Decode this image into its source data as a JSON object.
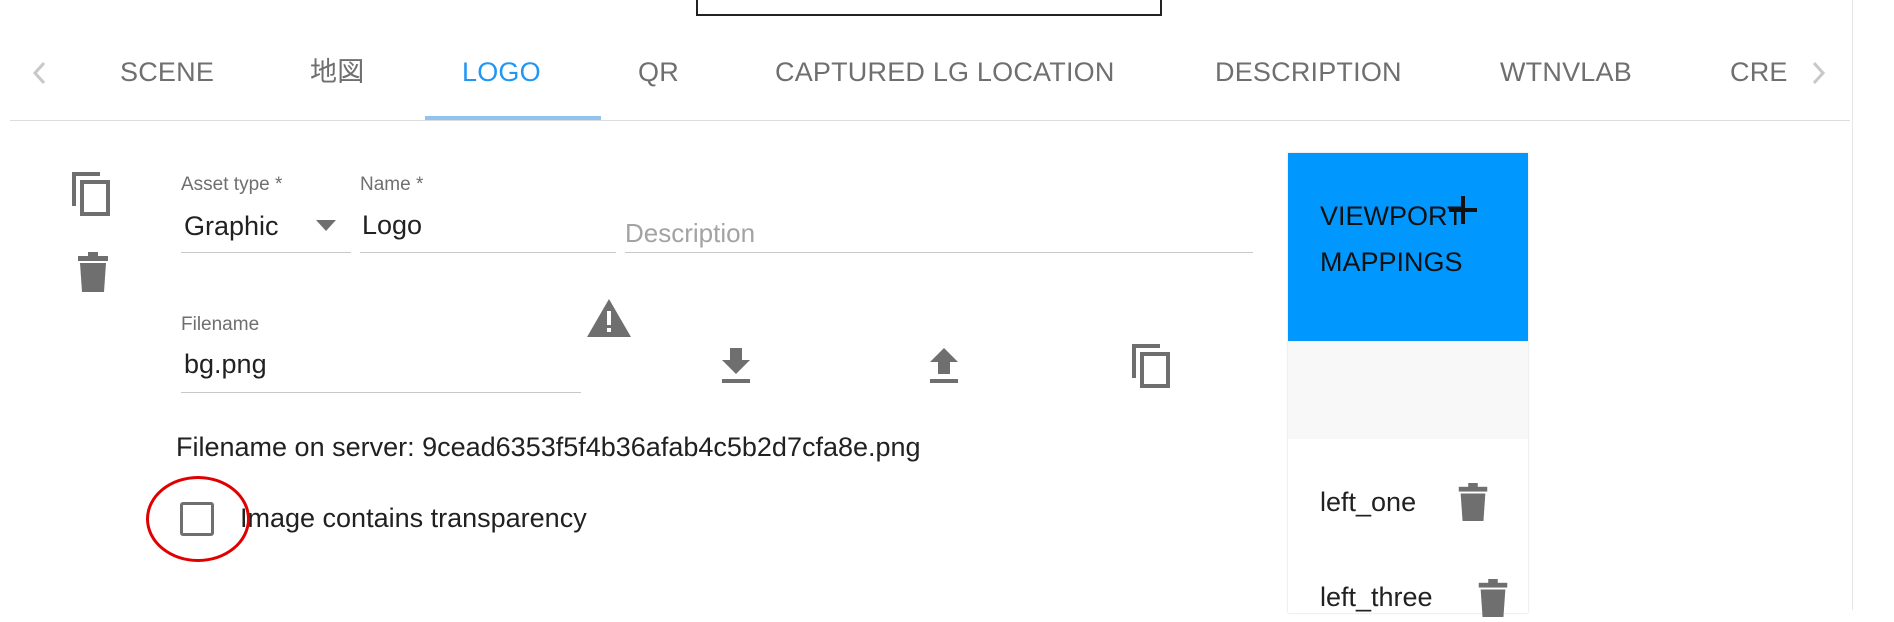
{
  "tabs": {
    "items": [
      "SCENE",
      "地図",
      "LOGO",
      "QR",
      "CAPTURED LG LOCATION",
      "DESCRIPTION",
      "WTNVLAB",
      "CRE"
    ],
    "active_index": 2,
    "active_color": "#2196f3"
  },
  "icons": {
    "prev": "chevron-left-icon",
    "next": "chevron-right-icon",
    "duplicate": "copy-icon",
    "delete": "trash-icon",
    "warning": "warning-icon",
    "download": "download-icon",
    "upload": "upload-icon",
    "copy_file": "copy-icon",
    "add": "plus-icon"
  },
  "form": {
    "asset_type": {
      "label": "Asset type *",
      "value": "Graphic"
    },
    "name": {
      "label": "Name *",
      "value": "Logo"
    },
    "description": {
      "placeholder": "Description"
    },
    "filename": {
      "label": "Filename",
      "value": "bg.png"
    },
    "server_filename_text": "Filename on server: 9cead6353f5f4b36afab4c5b2d7cfa8e.png",
    "transparency": {
      "label": "Image contains transparency",
      "checked": false
    }
  },
  "viewport": {
    "title": "VIEWPORT MAPPINGS",
    "header_color": "#0098ff",
    "items": [
      "left_one",
      "left_three"
    ]
  },
  "annotation": {
    "color": "#e10000"
  }
}
